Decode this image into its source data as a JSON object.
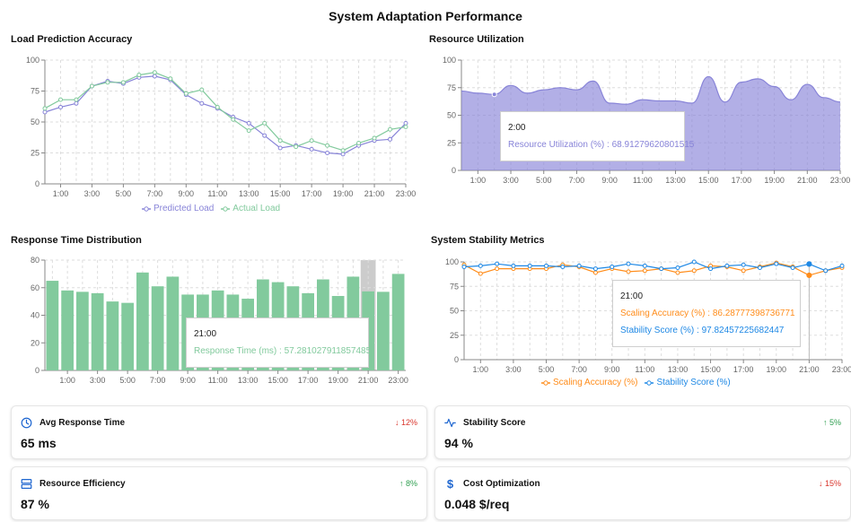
{
  "page": {
    "title": "System Adaptation Performance"
  },
  "colors": {
    "predicted": "#8884d8",
    "actual": "#82ca9d",
    "resource_fill": "#8884d8",
    "response_bar": "#82ca9d",
    "scaling": "#ff8c1a",
    "stability": "#1e88e5",
    "grid": "#dddddd",
    "axis": "#888888",
    "card_icon": "#1e66d0"
  },
  "chart_data": [
    {
      "id": "load",
      "type": "line",
      "title": "Load Prediction Accuracy",
      "categories": [
        "0:00",
        "1:00",
        "2:00",
        "3:00",
        "4:00",
        "5:00",
        "6:00",
        "7:00",
        "8:00",
        "9:00",
        "10:00",
        "11:00",
        "12:00",
        "13:00",
        "14:00",
        "15:00",
        "16:00",
        "17:00",
        "18:00",
        "19:00",
        "20:00",
        "21:00",
        "22:00",
        "23:00"
      ],
      "tick_labels": [
        "1:00",
        "3:00",
        "5:00",
        "7:00",
        "9:00",
        "11:00",
        "13:00",
        "15:00",
        "17:00",
        "19:00",
        "21:00",
        "23:00"
      ],
      "yticks": [
        0,
        25,
        50,
        75,
        100
      ],
      "ylim": [
        0,
        100
      ],
      "series": [
        {
          "name": "Predicted Load",
          "color": "#8884d8",
          "values": [
            58,
            62,
            65,
            79,
            83,
            81,
            86,
            87,
            84,
            72,
            65,
            61,
            54,
            49,
            39,
            29,
            31,
            28,
            25,
            24,
            31,
            35,
            36,
            49
          ]
        },
        {
          "name": "Actual Load",
          "color": "#82ca9d",
          "values": [
            61,
            68,
            68,
            79,
            82,
            82,
            88,
            90,
            85,
            73,
            76,
            62,
            52,
            43,
            49,
            35,
            30,
            35,
            31,
            27,
            33,
            37,
            44,
            46
          ]
        }
      ],
      "legend": "bottom"
    },
    {
      "id": "resource",
      "type": "area",
      "title": "Resource Utilization",
      "categories": [
        "0:00",
        "1:00",
        "2:00",
        "3:00",
        "4:00",
        "5:00",
        "6:00",
        "7:00",
        "8:00",
        "9:00",
        "10:00",
        "11:00",
        "12:00",
        "13:00",
        "14:00",
        "15:00",
        "16:00",
        "17:00",
        "18:00",
        "19:00",
        "20:00",
        "21:00",
        "22:00",
        "23:00"
      ],
      "tick_labels": [
        "1:00",
        "3:00",
        "5:00",
        "7:00",
        "9:00",
        "11:00",
        "13:00",
        "15:00",
        "17:00",
        "19:00",
        "21:00",
        "23:00"
      ],
      "yticks": [
        0,
        25,
        50,
        75,
        100
      ],
      "ylim": [
        0,
        100
      ],
      "series": [
        {
          "name": "Resource Utilization (%)",
          "color": "#8884d8",
          "values": [
            72,
            70,
            68.91279620801515,
            77,
            70,
            73,
            75,
            73,
            81,
            61,
            60,
            64,
            63,
            63,
            61,
            85,
            62,
            80,
            83,
            76,
            64,
            78,
            66,
            62
          ]
        }
      ],
      "tooltip": {
        "category": "2:00",
        "label": "Resource Utilization (%)",
        "value": "68.91279620801515"
      }
    },
    {
      "id": "response",
      "type": "bar",
      "title": "Response Time Distribution",
      "categories": [
        "0:00",
        "1:00",
        "2:00",
        "3:00",
        "4:00",
        "5:00",
        "6:00",
        "7:00",
        "8:00",
        "9:00",
        "10:00",
        "11:00",
        "12:00",
        "13:00",
        "14:00",
        "15:00",
        "16:00",
        "17:00",
        "18:00",
        "19:00",
        "20:00",
        "21:00",
        "22:00",
        "23:00"
      ],
      "tick_labels": [
        "1:00",
        "3:00",
        "5:00",
        "7:00",
        "9:00",
        "11:00",
        "13:00",
        "15:00",
        "17:00",
        "19:00",
        "21:00",
        "23:00"
      ],
      "yticks": [
        0,
        20,
        40,
        60,
        80
      ],
      "ylim": [
        0,
        80
      ],
      "series": [
        {
          "name": "Response Time (ms)",
          "color": "#82ca9d",
          "values": [
            65,
            58,
            57,
            56,
            50,
            49,
            71,
            61,
            68,
            55,
            55,
            58,
            55,
            52,
            66,
            64,
            61,
            56,
            66,
            54,
            68,
            57.281027911857485,
            57,
            70
          ]
        }
      ],
      "highlight_index": 21,
      "tooltip": {
        "category": "21:00",
        "label": "Response Time (ms)",
        "value": "57.281027911857485"
      }
    },
    {
      "id": "stability",
      "type": "line",
      "title": "System Stability Metrics",
      "categories": [
        "0:00",
        "1:00",
        "2:00",
        "3:00",
        "4:00",
        "5:00",
        "6:00",
        "7:00",
        "8:00",
        "9:00",
        "10:00",
        "11:00",
        "12:00",
        "13:00",
        "14:00",
        "15:00",
        "16:00",
        "17:00",
        "18:00",
        "19:00",
        "20:00",
        "21:00",
        "22:00",
        "23:00"
      ],
      "tick_labels": [
        "1:00",
        "3:00",
        "5:00",
        "7:00",
        "9:00",
        "11:00",
        "13:00",
        "15:00",
        "17:00",
        "19:00",
        "21:00",
        "23:00"
      ],
      "yticks": [
        0,
        25,
        50,
        75,
        100
      ],
      "ylim": [
        0,
        100
      ],
      "series": [
        {
          "name": "Scaling Accuracy (%)",
          "color": "#ff8c1a",
          "values": [
            97,
            88,
            93,
            93,
            93,
            93,
            97,
            95,
            89,
            93,
            90,
            91,
            93,
            89,
            91,
            96,
            95,
            91,
            95,
            99,
            95,
            86.28777398736771,
            91,
            94
          ]
        },
        {
          "name": "Stability Score (%)",
          "color": "#1e88e5",
          "values": [
            95,
            96,
            98,
            96,
            96,
            96,
            95,
            96,
            93,
            95,
            98,
            96,
            93,
            94,
            100,
            93,
            96,
            97,
            94,
            98,
            94,
            97.82457225682447,
            91,
            96
          ]
        }
      ],
      "legend": "bottom",
      "tooltip": {
        "category": "21:00",
        "rows": [
          {
            "label": "Scaling Accuracy (%)",
            "value": "86.28777398736771"
          },
          {
            "label": "Stability Score (%)",
            "value": "97.82457225682447"
          }
        ]
      }
    }
  ],
  "cards": [
    {
      "label": "Avg Response Time",
      "value": "65 ms",
      "change": "↓ 12%",
      "direction": "down",
      "icon": "clock-icon"
    },
    {
      "label": "Stability Score",
      "value": "94 %",
      "change": "↑ 5%",
      "direction": "up",
      "icon": "activity-icon"
    },
    {
      "label": "Resource Efficiency",
      "value": "87 %",
      "change": "↑ 8%",
      "direction": "up",
      "icon": "server-icon"
    },
    {
      "label": "Cost Optimization",
      "value": "0.048 $/req",
      "change": "↓ 15%",
      "direction": "down",
      "icon": "dollar-icon"
    }
  ]
}
